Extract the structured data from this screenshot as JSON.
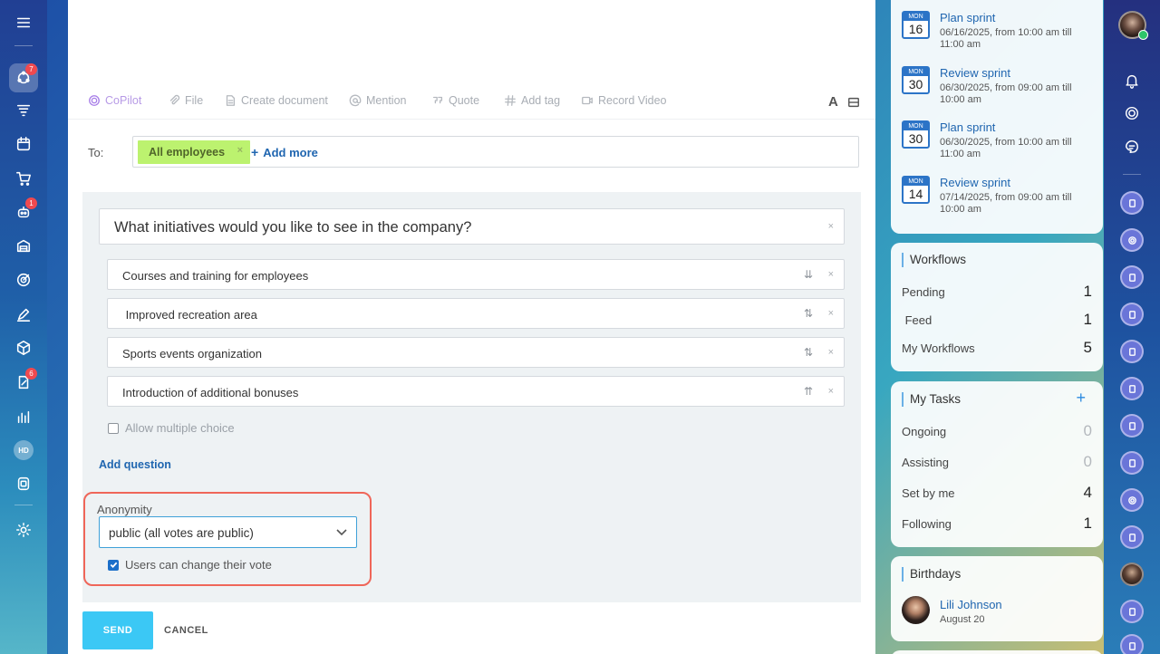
{
  "left_nav": {
    "badges": {
      "feed": "7",
      "bot": "1",
      "tasks": "6"
    },
    "hd_label": "HD"
  },
  "toolbar": {
    "copilot": "CoPilot",
    "file": "File",
    "create_document": "Create document",
    "mention": "Mention",
    "quote": "Quote",
    "add_tag": "Add tag",
    "record_video": "Record Video",
    "font_label": "A"
  },
  "recipients": {
    "label": "To:",
    "chip": "All employees",
    "add_more": "Add more"
  },
  "poll": {
    "question": "What initiatives would you like to see in the company?",
    "answers": [
      {
        "text": "Courses and training for employees",
        "sort": "⇊"
      },
      {
        "text": " Improved recreation area",
        "sort": "⇅"
      },
      {
        "text": "Sports events organization",
        "sort": "⇅"
      },
      {
        "text": "Introduction of additional bonuses",
        "sort": "⇈"
      }
    ],
    "allow_multiple": "Allow multiple choice",
    "add_question": "Add question",
    "anonymity_label": "Anonymity",
    "anonymity_value": "public (all votes are public)",
    "change_vote": "Users can change their vote"
  },
  "actions": {
    "send": "SEND",
    "cancel": "CANCEL"
  },
  "calendar": [
    {
      "mon": "MON",
      "day": "16",
      "title": "Plan sprint",
      "sub": "06/16/2025, from 10:00 am till 11:00 am"
    },
    {
      "mon": "MON",
      "day": "30",
      "title": "Review sprint",
      "sub": "06/30/2025, from 09:00 am till 10:00 am"
    },
    {
      "mon": "MON",
      "day": "30",
      "title": "Plan sprint",
      "sub": "06/30/2025, from 10:00 am till 11:00 am"
    },
    {
      "mon": "MON",
      "day": "14",
      "title": "Review sprint",
      "sub": "07/14/2025, from 09:00 am till 10:00 am"
    }
  ],
  "workflows": {
    "title": "Workflows",
    "rows": [
      {
        "label": "Pending",
        "value": "1"
      },
      {
        "label": " Feed",
        "value": "1"
      },
      {
        "label": "My Workflows",
        "value": "5"
      }
    ]
  },
  "tasks": {
    "title": "My Tasks",
    "rows": [
      {
        "label": "Ongoing",
        "value": "0"
      },
      {
        "label": "Assisting",
        "value": "0"
      },
      {
        "label": "Set by me",
        "value": "4"
      },
      {
        "label": "Following",
        "value": "1"
      }
    ]
  },
  "birthdays": {
    "title": "Birthdays",
    "name": "Lili Johnson",
    "date": "August 20"
  },
  "colors": {
    "accent": "#2066b0",
    "send": "#3bc8f5",
    "chip": "#bcf26f",
    "highlight_frame": "#ef6659"
  }
}
